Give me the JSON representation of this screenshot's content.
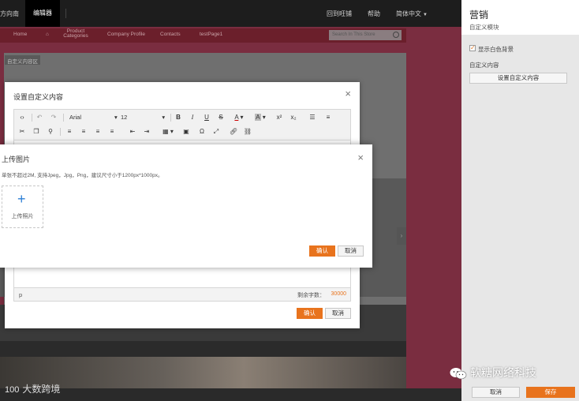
{
  "topbar": {
    "nav_left": "方向南",
    "nav_active": "编辑器",
    "view_site": "回到旺铺",
    "help": "帮助",
    "language": "简体中文"
  },
  "site": {
    "nav": [
      "Home",
      "Product Categories",
      "Company Profile",
      "Contacts",
      "testPage1"
    ],
    "search_placeholder": "Search In This Store",
    "region_tag": "自定义内容区"
  },
  "panel": {
    "title": "营销",
    "subtitle": "自定义模块",
    "checkbox_label": "显示白色背景",
    "section_label": "自定义内容",
    "set_button": "设置自定义内容",
    "cancel": "取消",
    "save": "保存"
  },
  "editor": {
    "title": "设置自定义内容",
    "font": "Arial",
    "size": "12",
    "path": "p",
    "remaining_label": "剩余字数：",
    "remaining_value": "30000",
    "ok": "确认",
    "cancel": "取消"
  },
  "upload": {
    "title": "上传图片",
    "hint": "单张不超过2M, 支持Jpeg，Jpg，Png，建议尺寸小于1200px*1000px。",
    "box_label": "上传照片",
    "ok": "确认",
    "cancel": "取消"
  },
  "watermark": {
    "left_logo": "100",
    "left": "大数跨境",
    "right": "软糖网络科技"
  },
  "colors": {
    "accent": "#e8731d",
    "topbar": "#1d1d1d",
    "plus_icon": "#2d7fd6"
  }
}
